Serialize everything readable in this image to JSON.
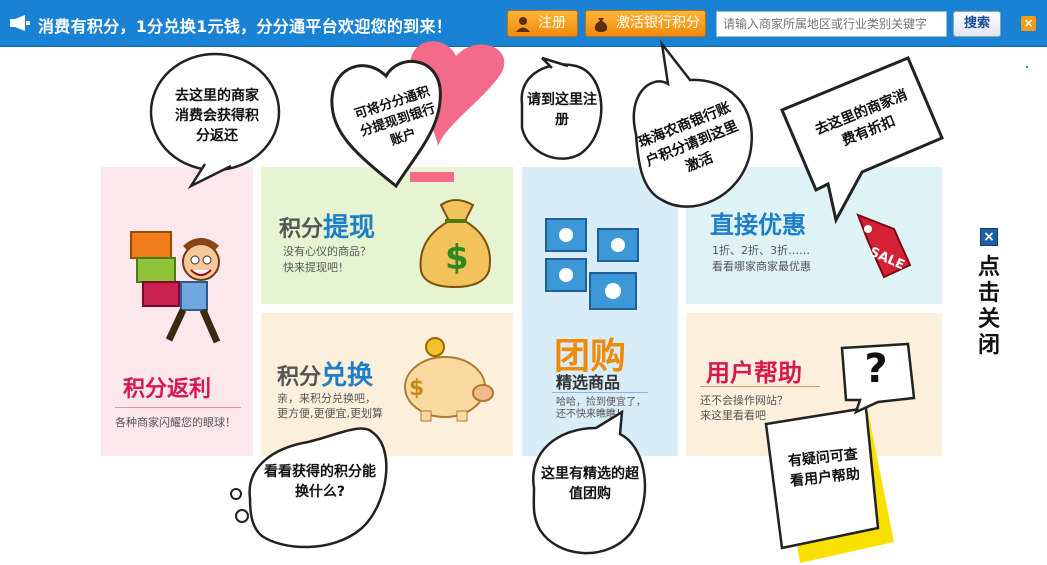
{
  "topbar": {
    "message": "消费有积分，1分兑换1元钱，分分通平台欢迎您的到来！",
    "register_label": "注册",
    "activate_label": "激活银行积分",
    "search_placeholder": "请输入商家所属地区或行业类别关键字",
    "search_label": "搜索",
    "close_label": "×",
    "accent_color": "#1a82d4",
    "button_color": "#f39c12"
  },
  "tiles": {
    "rebate": {
      "title": "积分返利",
      "subtitle": "各种商家闪耀您的眼球！"
    },
    "cashout": {
      "title_prefix": "积分",
      "title_main": "提现",
      "line1": "没有心仪的商品？",
      "line2": "快来提现吧！"
    },
    "exchange": {
      "title_prefix": "积分",
      "title_main": "兑换",
      "line1": "亲，来积分兑换吧，",
      "line2": "更方便,更便宜,更划算"
    },
    "groupbuy": {
      "title": "团购",
      "subtitle": "精选商品",
      "line1": "哈哈，捡到便宜了，",
      "line2": "还不快来瞧瞧！"
    },
    "discount": {
      "title": "直接优惠",
      "line1": "1折、2折、3折……",
      "line2": "看看哪家商家最优惠",
      "tag": "SALE"
    },
    "help": {
      "title": "用户帮助",
      "line1": "还不会操作网站？",
      "line2": "来这里看看吧",
      "icon_text": "?"
    }
  },
  "bubbles": {
    "earn": "去这里的商家消费会获得积分返还",
    "withdraw": "可将分分通积分提现到银行账户",
    "register": "请到这里注册",
    "bank": "珠海农商银行账户积分请到这里激活",
    "discount": "去这里的商家消费有折扣",
    "exchange": "看看获得的积分能换什么?",
    "groupbuy": "这里有精选的超值团购",
    "help": "有疑问可查看用户帮助"
  },
  "side": {
    "close_icon": "×",
    "close_text": "点击关闭"
  }
}
